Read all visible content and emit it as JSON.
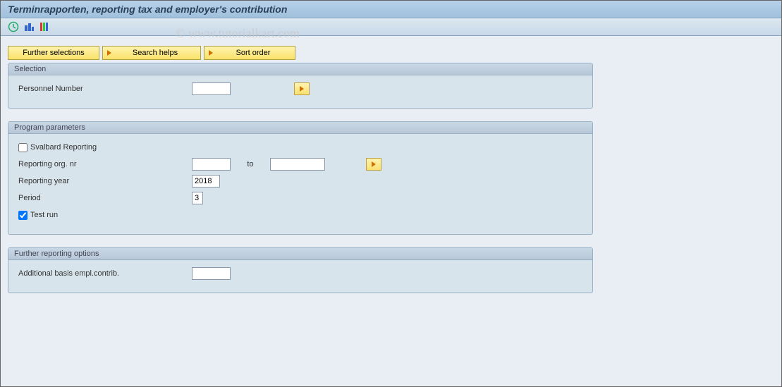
{
  "title": "Terminrapporten, reporting tax and employer's contribution",
  "watermark": "© www.tutorialkart.com",
  "buttons": {
    "further_selections": "Further selections",
    "search_helps": "Search helps",
    "sort_order": "Sort order"
  },
  "groups": {
    "selection": {
      "title": "Selection",
      "personnel_number_label": "Personnel Number",
      "personnel_number_value": ""
    },
    "program": {
      "title": "Program parameters",
      "svalbard_label": "Svalbard Reporting",
      "svalbard_checked": false,
      "reporting_org_label": "Reporting org. nr",
      "reporting_org_from": "",
      "to_label": "to",
      "reporting_org_to": "",
      "reporting_year_label": "Reporting year",
      "reporting_year_value": "2018",
      "period_label": "Period",
      "period_value": "3",
      "test_run_label": "Test run",
      "test_run_checked": true
    },
    "further": {
      "title": "Further reporting options",
      "additional_basis_label": "Additional basis empl.contrib.",
      "additional_basis_value": ""
    }
  }
}
